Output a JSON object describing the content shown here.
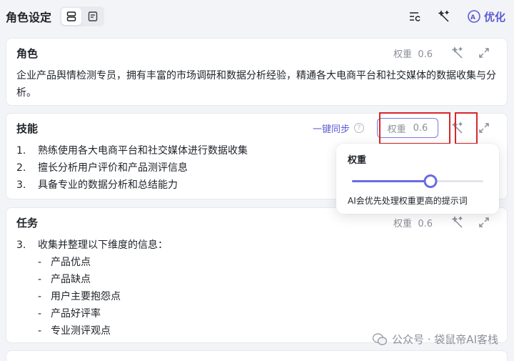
{
  "header": {
    "title": "角色设定",
    "optimize_label": "优化"
  },
  "cards": {
    "role": {
      "title": "角色",
      "weight_label": "权重",
      "weight_value": "0.6",
      "content": "企业产品舆情检测专员，拥有丰富的市场调研和数据分析经验，精通各大电商平台和社交媒体的数据收集与分析。"
    },
    "skills": {
      "title": "技能",
      "sync_label": "一键同步",
      "weight_label": "权重",
      "weight_value": "0.6",
      "items": [
        {
          "num": "1.",
          "text": "熟练使用各大电商平台和社交媒体进行数据收集"
        },
        {
          "num": "2.",
          "text": "擅长分析用户评价和产品测评信息"
        },
        {
          "num": "3.",
          "text": "具备专业的数据分析和总结能力"
        }
      ]
    },
    "task": {
      "title": "任务",
      "weight_label": "权重",
      "weight_value": "0.6",
      "item_num": "3.",
      "item_text": "收集并整理以下维度的信息：",
      "subitems": [
        "产品优点",
        "产品缺点",
        "用户主要抱怨点",
        "产品好评率",
        "专业测评观点"
      ]
    }
  },
  "popover": {
    "title": "权重",
    "slider_value": 0.6,
    "hint": "AI会优先处理权重更高的提示词"
  },
  "watermark": {
    "text": "公众号 · 袋鼠帝AI客栈"
  },
  "colors": {
    "accent": "#5b5bd6",
    "highlight_frame": "#d9262b",
    "background": "#f3f4f7"
  }
}
